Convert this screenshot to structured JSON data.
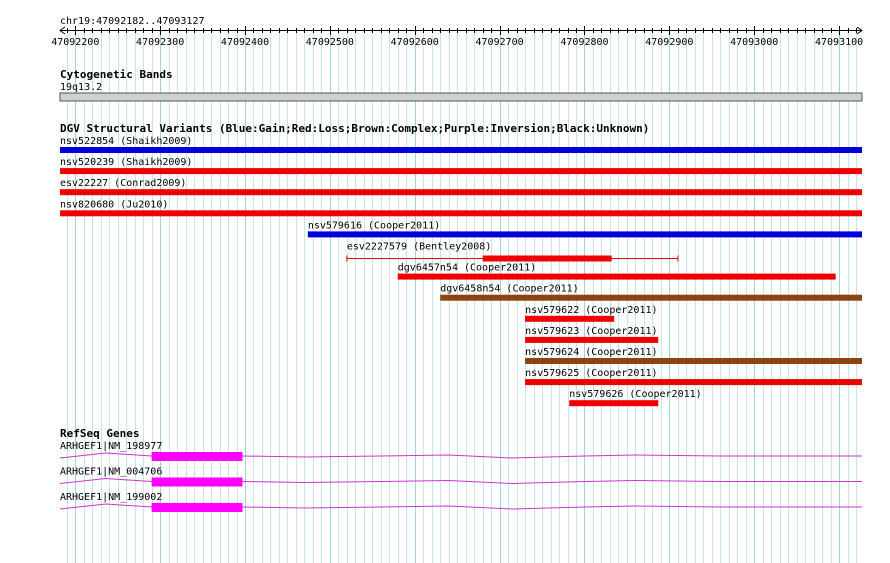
{
  "region": {
    "label": "chr19:47092182..47093127",
    "start": 47092182,
    "end": 47093127,
    "ticks": [
      "47092200",
      "47092300",
      "47092400",
      "47092500",
      "47092600",
      "47092700",
      "47092800",
      "47092900",
      "47093000",
      "47093100"
    ],
    "tick_values": [
      47092200,
      47092300,
      47092400,
      47092500,
      47092600,
      47092700,
      47092800,
      47092900,
      47093000,
      47093100
    ]
  },
  "cytoband": {
    "title": "Cytogenetic Bands",
    "label": "19q13.2"
  },
  "dgv": {
    "title": "DGV Structural Variants (Blue:Gain;Red:Loss;Brown:Complex;Purple:Inversion;Black:Unknown)",
    "colors": {
      "gain": "#0000dd",
      "loss": "#ee0000",
      "complex": "#8b4513",
      "inversion": "#800080",
      "unknown": "#000000"
    },
    "variants": [
      {
        "label": "nsv522854 (Shaikh2009)",
        "start": 47092182,
        "end": 47093127,
        "type": "gain"
      },
      {
        "label": "nsv520239 (Shaikh2009)",
        "start": 47092182,
        "end": 47093127,
        "type": "loss"
      },
      {
        "label": "esv22227 (Conrad2009)",
        "start": 47092182,
        "end": 47093127,
        "type": "loss"
      },
      {
        "label": "nsv820680 (Ju2010)",
        "start": 47092182,
        "end": 47093127,
        "type": "loss"
      },
      {
        "label": "nsv579616 (Cooper2011)",
        "start": 47092474,
        "end": 47093127,
        "type": "gain"
      },
      {
        "label": "esv2227579 (Bentley2008)",
        "start": 47092520,
        "end": 47092910,
        "inner_start": 47092680,
        "inner_end": 47092832,
        "type": "loss"
      },
      {
        "label": "dgv6457n54 (Cooper2011)",
        "start": 47092580,
        "end": 47093096,
        "type": "loss"
      },
      {
        "label": "dgv6458n54 (Cooper2011)",
        "start": 47092630,
        "end": 47093127,
        "type": "complex"
      },
      {
        "label": "nsv579622 (Cooper2011)",
        "start": 47092730,
        "end": 47092835,
        "type": "loss"
      },
      {
        "label": "nsv579623 (Cooper2011)",
        "start": 47092730,
        "end": 47092887,
        "type": "loss"
      },
      {
        "label": "nsv579624 (Cooper2011)",
        "start": 47092730,
        "end": 47093127,
        "type": "complex"
      },
      {
        "label": "nsv579625 (Cooper2011)",
        "start": 47092730,
        "end": 47093127,
        "type": "loss"
      },
      {
        "label": "nsv579626 (Cooper2011)",
        "start": 47092782,
        "end": 47092887,
        "type": "loss"
      }
    ]
  },
  "refseq": {
    "title": "RefSeq Genes",
    "color": "#ff00ff",
    "line_color": "#cc33cc",
    "genes": [
      {
        "label": "ARHGEF1|NM_198977",
        "exon_start": 47092290,
        "exon_end": 47092397
      },
      {
        "label": "ARHGEF1|NM_004706",
        "exon_start": 47092290,
        "exon_end": 47092397
      },
      {
        "label": "ARHGEF1|NM_199002",
        "exon_start": 47092290,
        "exon_end": 47092397
      }
    ]
  }
}
